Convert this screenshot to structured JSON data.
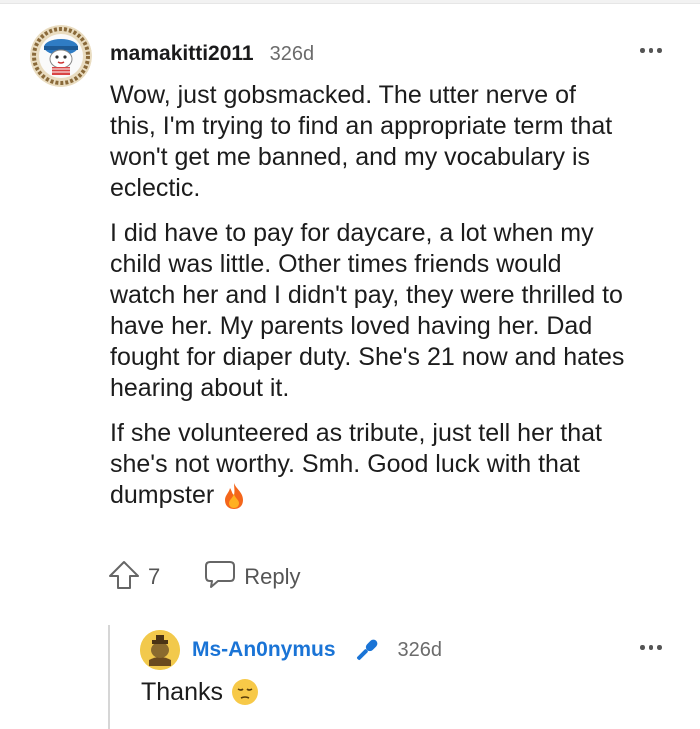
{
  "comment": {
    "username": "mamakitti2011",
    "age": "326d",
    "paragraphs": [
      "Wow, just gobsmacked. The utter nerve of\nthis, I'm trying to find an appropriate term that\nwon't get me banned, and my vocabulary is\neclectic.",
      "I did have to pay for daycare, a lot when my\nchild was little. Other times friends would\nwatch her and I didn't pay, they were thrilled to\nhave her. My parents loved having her. Dad\nfought for diaper duty. She's 21 now and hates\nhearing about it.",
      "If she volunteered as tribute, just tell her that\nshe's not worthy. Smh. Good luck with that\ndumpster"
    ],
    "emoji": "fire-emoji",
    "vote_count": "7",
    "reply_label": "Reply"
  },
  "reply": {
    "username": "Ms-An0nymus",
    "age": "326d",
    "text": "Thanks",
    "emoji": "pensive-face-emoji"
  },
  "colors": {
    "username_reply": "#1a74d6",
    "mic": "#1a74d6",
    "muted": "#6b6b6b"
  }
}
